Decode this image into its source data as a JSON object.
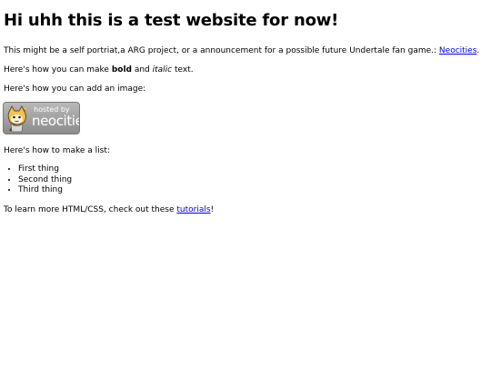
{
  "heading": "Hi uhh this is a test website for now!",
  "intro": {
    "text": "This might be a self portriat,a ARG project, or a announcement for a possible future Undertale fan game.: ",
    "link": "Neocities",
    "after": "."
  },
  "bold_line": {
    "prefix": "Here's how you can make ",
    "bold": "bold",
    "middle": " and ",
    "italic": "italic",
    "suffix": " text."
  },
  "image_line": "Here's how you can add an image:",
  "badge": {
    "small": "hosted by",
    "big": "neocities"
  },
  "list_intro": "Here's how to make a list:",
  "list_items": [
    "First thing",
    "Second thing",
    "Third thing"
  ],
  "outro": {
    "text": "To learn more HTML/CSS, check out these ",
    "link": "tutorials",
    "after": "!"
  }
}
